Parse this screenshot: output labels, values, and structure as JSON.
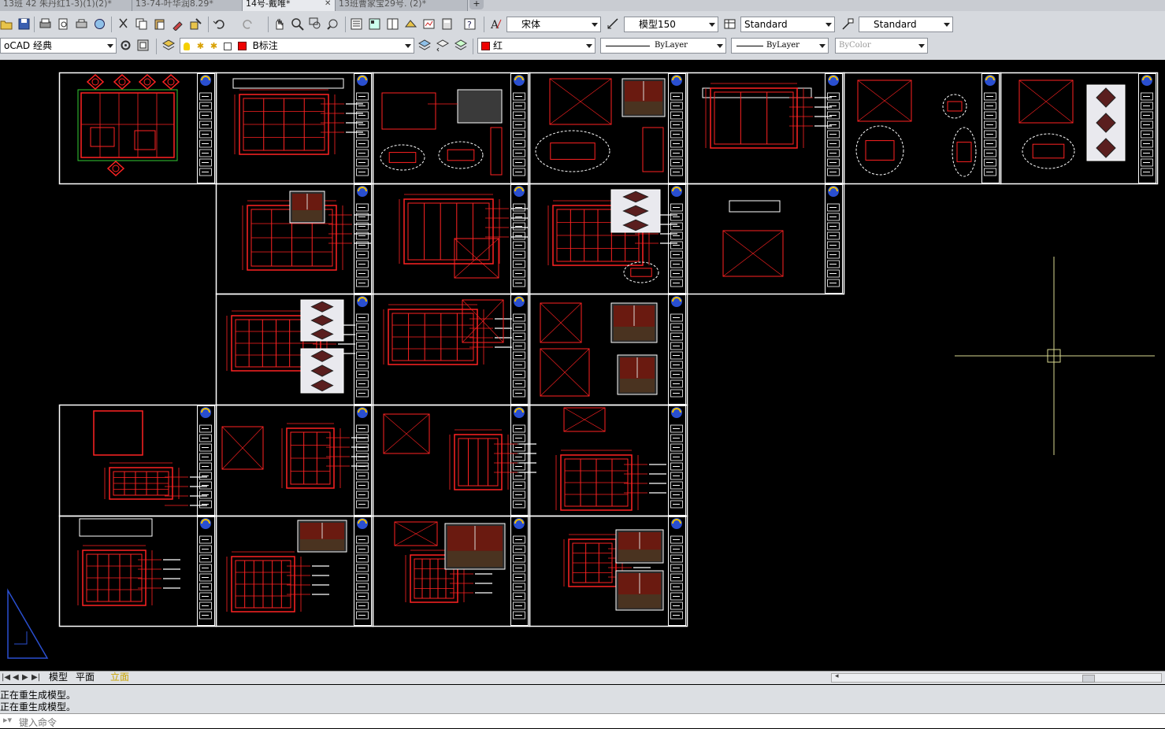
{
  "doc_tabs": [
    {
      "label": "13班 42 朱丹红1-3)(1)(2)*",
      "active": false
    },
    {
      "label": "13-74-叶华润8.29*",
      "active": false
    },
    {
      "label": "14号-戴唯*",
      "active": true
    },
    {
      "label": "13班曹家宝29号. (2)*",
      "active": false
    }
  ],
  "toolbar": {
    "text_style_font": "宋体",
    "dim_scale": "模型150",
    "table_style": "Standard",
    "multileader_style": "Standard",
    "workspace": "oCAD 经典",
    "layer": "B标注",
    "color": "红",
    "linetype": "ByLayer",
    "lineweight": "ByLayer",
    "plot_style": "ByColor"
  },
  "layout_tabs": [
    "模型",
    "平面",
    "立面"
  ],
  "active_layout": "立面",
  "command_history": [
    "正在重生成模型。",
    "正在重生成模型。"
  ],
  "command_prompt": "键入命令",
  "colors": {
    "drawing_red": "#ff2222",
    "frame_white": "#ffffff",
    "crosshair": "#d8d890",
    "canvas": "#000000",
    "logo_blue": "#2a4fd0",
    "logo_yellow": "#f0c000"
  }
}
